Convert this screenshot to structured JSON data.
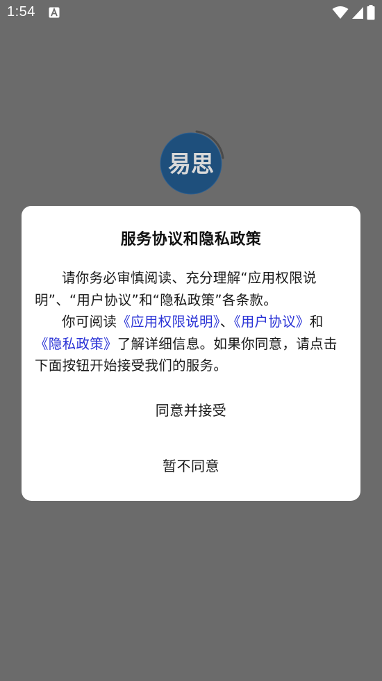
{
  "status_bar": {
    "time": "1:54",
    "notification_icon": "font-a-icon",
    "icons": [
      "wifi-icon",
      "signal-icon",
      "battery-icon"
    ]
  },
  "splash": {
    "logo_text": "易思",
    "logo_color": "#1f5f97"
  },
  "dialog": {
    "title": "服务协议和隐私政策",
    "paragraph1": "请你务必审慎阅读、充分理解“应用权限说明”、“用户协议”和“隐私政策”各条款。",
    "paragraph2": {
      "prefix": "你可阅读",
      "link_permissions": "《应用权限说明》",
      "sep1": "、",
      "link_user_agreement": "《用户协议》",
      "sep2": "和",
      "link_privacy": "《隐私政策》",
      "suffix": "了解详细信息。如果你同意，请点击下面按钮开始接受我们的服务。"
    },
    "accept_label": "同意并接受",
    "decline_label": "暂不同意"
  },
  "colors": {
    "overlay": "#6b6b6b",
    "dialog_bg": "#ffffff",
    "link": "#2a33d6"
  }
}
